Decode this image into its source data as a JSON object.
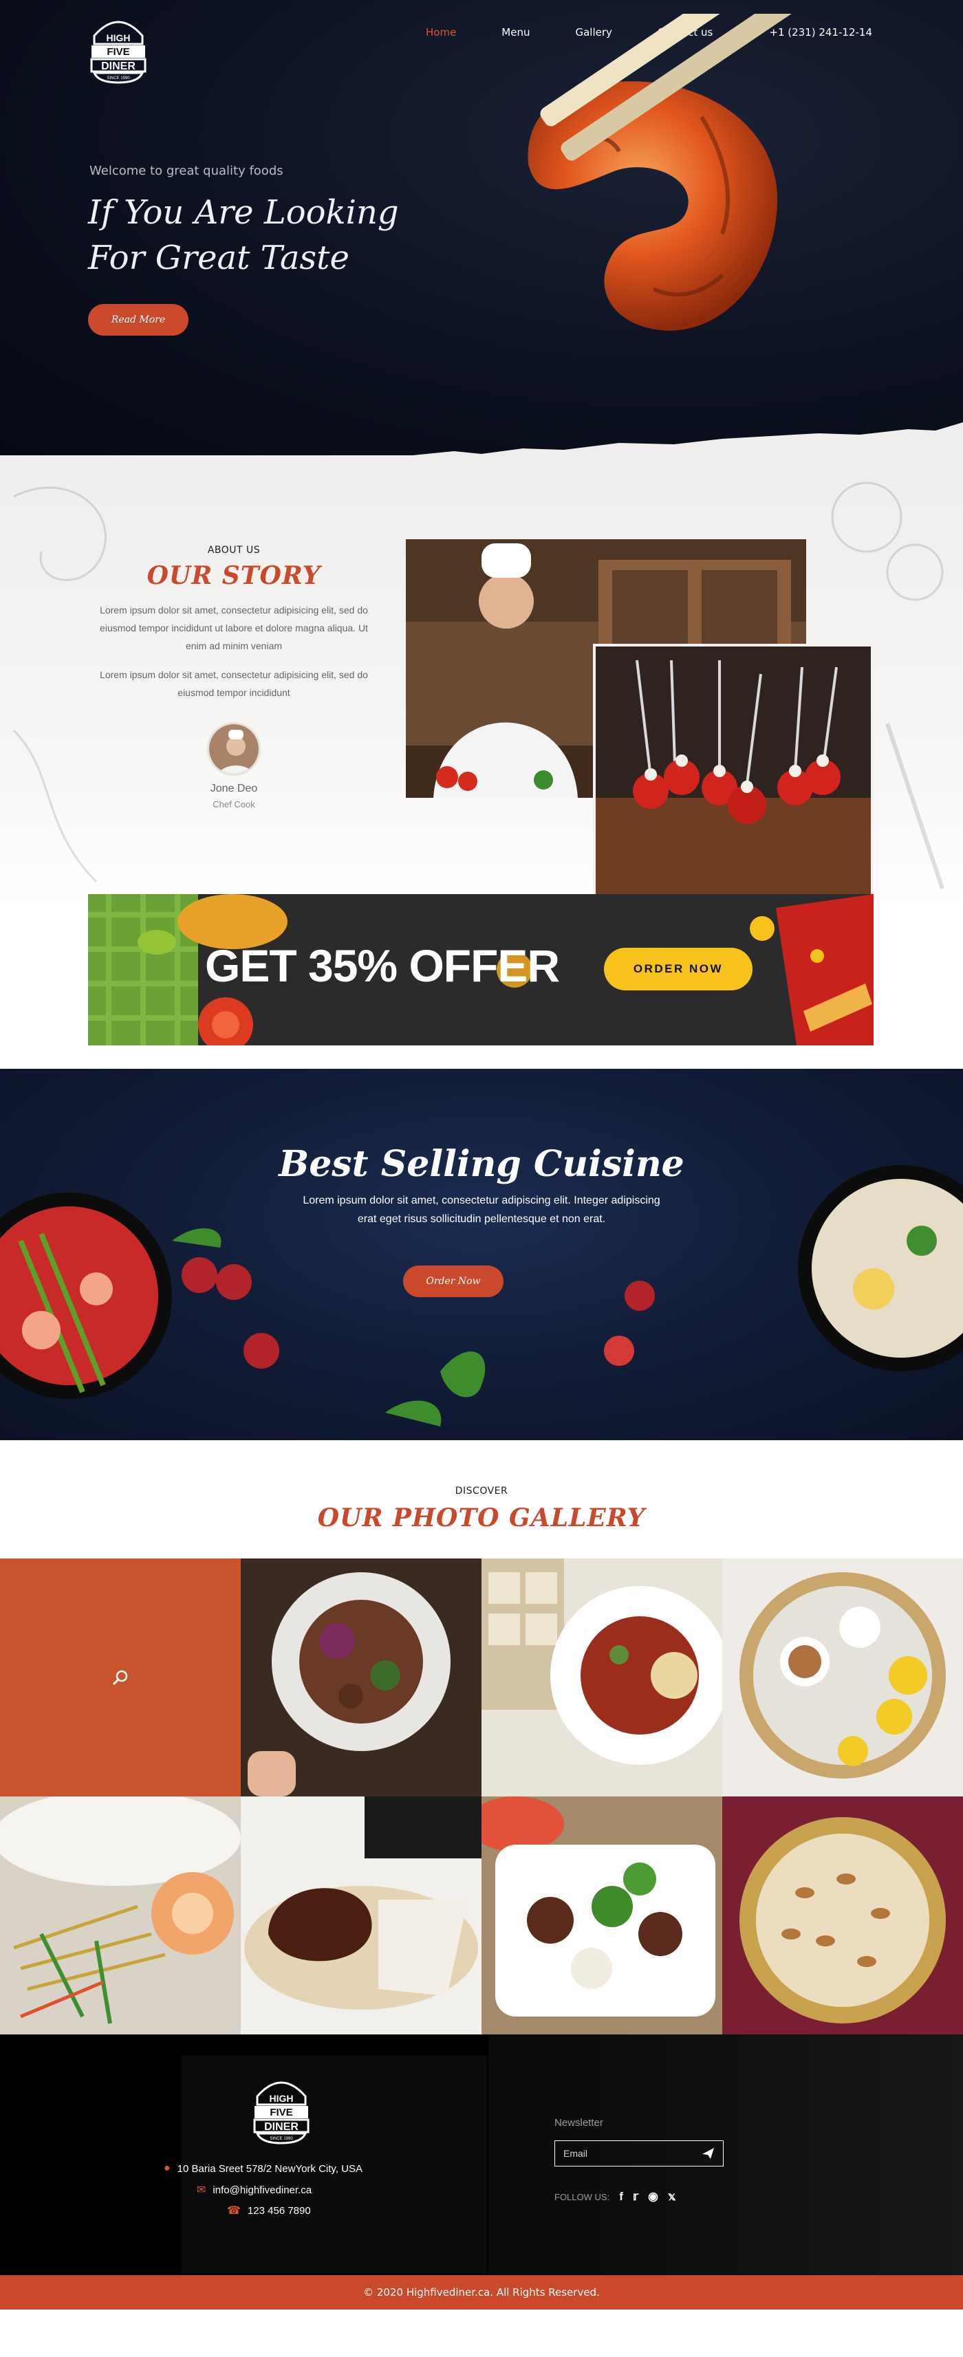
{
  "brand": {
    "logo_lines": [
      "HIGH",
      "FIVE",
      "DINER"
    ],
    "logo_tagline": "SINCE 1990"
  },
  "nav": {
    "items": [
      {
        "label": "Home",
        "active": true
      },
      {
        "label": "Menu"
      },
      {
        "label": "Gallery"
      },
      {
        "label": "Contact us"
      }
    ],
    "phone": "+1 (231) 241-12-14"
  },
  "hero": {
    "kicker": "Welcome to great quality foods",
    "title_line1": "If You Are Looking",
    "title_line2": "For Great Taste",
    "button": "Read More"
  },
  "story": {
    "kicker": "ABOUT US",
    "title": "OUR STORY",
    "para1": "Lorem ipsum dolor sit amet, consectetur adipisicing elit, sed do eiusmod tempor incididunt ut labore et dolore magna aliqua. Ut enim ad minim veniam",
    "para2": "Lorem ipsum dolor sit amet, consectetur adipisicing elit, sed do eiusmod tempor incididunt",
    "chef_name": "Jone Deo",
    "chef_role": "Chef Cook"
  },
  "offer": {
    "headline": "GET 35% OFFER",
    "button": "ORDER NOW"
  },
  "best": {
    "title": "Best Selling Cuisine",
    "desc": "Lorem ipsum dolor sit amet, consectetur adipiscing elit. Integer adipiscing erat eget risus sollicitudin pellentesque et non erat.",
    "button": "Order Now"
  },
  "gallery": {
    "kicker": "DISCOVER",
    "title": "OUR PHOTO GALLERY"
  },
  "footer": {
    "address": "10 Baria Sreet 578/2 NewYork City, USA",
    "email": "info@highfivediner.ca",
    "phone": "123 456 7890",
    "newsletter_label": "Newsletter",
    "email_placeholder": "Email",
    "follow_label": "FOLLOW US:",
    "social": [
      "f",
      "t",
      "ig",
      "p"
    ],
    "copyright": "© 2020 Highfivediner.ca. All Rights Reserved."
  },
  "colors": {
    "accent": "#c9492a",
    "hero_bg": "#0c1120",
    "offer_yellow": "#f7c21c",
    "nav_active": "#e1542c"
  }
}
